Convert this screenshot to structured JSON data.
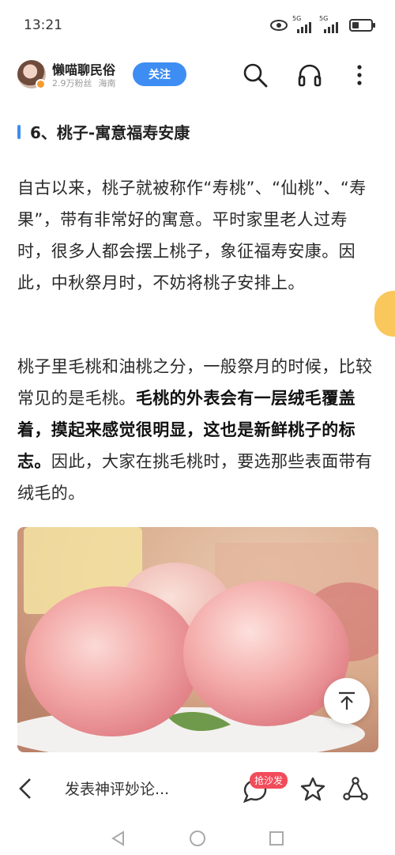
{
  "status_bar": {
    "time": "13:21",
    "signal1_label": "5G",
    "signal2_label": "5G"
  },
  "header": {
    "author_name": "懒喵聊民俗",
    "followers": "2.9万粉丝",
    "location": "海南",
    "follow_label": "关注"
  },
  "article": {
    "section_title": "6、桃子-寓意福寿安康",
    "para1": "自古以来，桃子就被称作“寿桃”、“仙桃”、“寿果”，带有非常好的寓意。平时家里老人过寿时，很多人都会摆上桃子，象征福寿安康。因此，中秋祭月时，不妨将桃子安排上。",
    "para2_start": "桃子里毛桃和油桃之分，一般祭月的时候，比较常见的是毛桃。",
    "para2_bold": "毛桃的外表会有一层绒毛覆盖着，摸起来感觉很明显，这也是新鲜桃子的标志。",
    "para2_end": "因此，大家在挑毛桃时，要选那些表面带有绒毛的。"
  },
  "bottom_bar": {
    "comment_placeholder": "发表神评妙论...",
    "sofa_badge": "抢沙发"
  },
  "icons": {
    "search": "search-icon",
    "headphones": "headphones-icon",
    "more": "more-icon",
    "back": "back-icon",
    "comment": "comment-icon",
    "star": "star-icon",
    "share": "share-icon",
    "scroll_top": "scroll-top-icon"
  },
  "colors": {
    "accent": "#3e8df3",
    "badge_red": "#f24b5a"
  }
}
